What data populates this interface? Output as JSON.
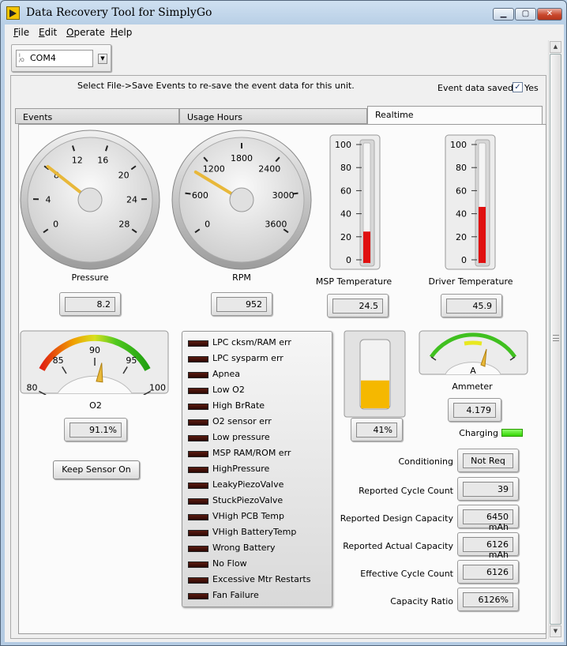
{
  "window": {
    "title": "Data Recovery Tool for SimplyGo",
    "min": "▁",
    "max": "▢",
    "close": "✕"
  },
  "menu": [
    {
      "label": "File",
      "accel": "F",
      "rest": "ile"
    },
    {
      "label": "Edit",
      "accel": "E",
      "rest": "dit"
    },
    {
      "label": "Operate",
      "accel": "O",
      "rest": "perate"
    },
    {
      "label": "Help",
      "accel": "H",
      "rest": "elp"
    }
  ],
  "com_port": {
    "value": "COM4",
    "io_icon": "I/O"
  },
  "hint_text": "Select File->Save Events to re-save the event data for this unit.",
  "event_saved": {
    "label": "Event data saved?",
    "checked": true,
    "check_glyph": "✓",
    "option": "Yes"
  },
  "tabs": [
    {
      "label": "Events",
      "active": false
    },
    {
      "label": "Usage Hours",
      "active": false
    },
    {
      "label": "Realtime",
      "active": true
    }
  ],
  "gauges": {
    "pressure": {
      "label": "Pressure",
      "value": "8.2",
      "ticks": [
        "0",
        "4",
        "8",
        "12",
        "16",
        "20",
        "24",
        "28"
      ],
      "reading": 8.2,
      "min": 0,
      "max": 28
    },
    "rpm": {
      "label": "RPM",
      "value": "952",
      "ticks": [
        "0",
        "600",
        "1200",
        "1800",
        "2400",
        "3000",
        "3600"
      ],
      "reading": 952,
      "min": 0,
      "max": 3600
    }
  },
  "thermometers": {
    "msp": {
      "label": "MSP Temperature",
      "value": "24.5",
      "ticks": [
        "100",
        "80",
        "60",
        "40",
        "20",
        "0"
      ],
      "level": 24.5
    },
    "driver": {
      "label": "Driver Temperature",
      "value": "45.9",
      "ticks": [
        "100",
        "80",
        "60",
        "40",
        "20",
        "0"
      ],
      "level": 45.9
    }
  },
  "o2": {
    "label": "O2",
    "value": "91.1%",
    "ticks": [
      "80",
      "85",
      "90",
      "95",
      "100"
    ],
    "reading": 91.1,
    "min": 80,
    "max": 100
  },
  "keep_sensor": {
    "label": "Keep Sensor On"
  },
  "alarms": [
    "LPC cksm/RAM err",
    "LPC sysparm err",
    "Apnea",
    "Low O2",
    "High BrRate",
    "O2 sensor err",
    "Low pressure",
    "MSP RAM/ROM err",
    "HighPressure",
    "LeakyPiezoValve",
    "StuckPiezoValve",
    "VHigh PCB Temp",
    "VHigh BatteryTemp",
    "Wrong Battery",
    "No Flow",
    "Excessive Mtr Restarts",
    "Fan Failure"
  ],
  "tank": {
    "value": "41%",
    "level": 41
  },
  "ammeter": {
    "label": "Ammeter",
    "unit": "A",
    "value": "4.179"
  },
  "charging": {
    "label": "Charging",
    "on": true
  },
  "battery": [
    {
      "label": "Conditioning",
      "value": "Not Req"
    },
    {
      "label": "Reported Cycle Count",
      "value": "39"
    },
    {
      "label": "Reported Design Capacity",
      "value": "6450 mAh"
    },
    {
      "label": "Reported Actual Capacity",
      "value": "6126 mAh"
    },
    {
      "label": "Effective Cycle Count",
      "value": "6126"
    },
    {
      "label": "Capacity Ratio",
      "value": "6126%"
    }
  ],
  "colors": {
    "needle": "#e8b83a",
    "thermo_fill": "#e01010",
    "tank_fill": "#f5b800",
    "led_on": "#33d400",
    "led_off": "#3a0c06"
  }
}
